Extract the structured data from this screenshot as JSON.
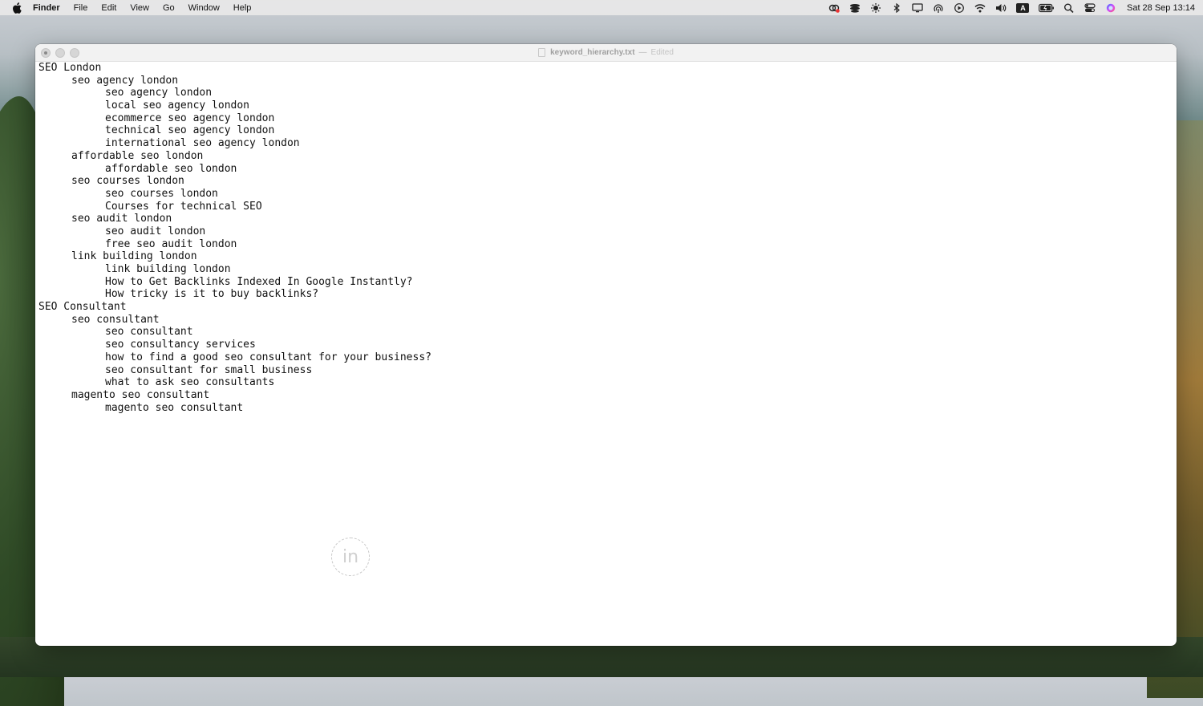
{
  "menubar": {
    "items": [
      "Finder",
      "File",
      "Edit",
      "View",
      "Go",
      "Window",
      "Help"
    ],
    "clock": "Sat 28 Sep  13:14",
    "status_icons": [
      "creative-cloud-icon",
      "stacks-icon",
      "brightness-icon",
      "bluetooth-icon",
      "display-icon",
      "airdrop-icon",
      "play-icon",
      "wifi-icon",
      "volume-icon",
      "input-source-icon",
      "battery-icon",
      "spotlight-icon",
      "control-center-icon",
      "siri-icon"
    ],
    "input_source_label": "A"
  },
  "window": {
    "filename": "keyword_hierarchy.txt",
    "separator": "—",
    "status": "Edited"
  },
  "editor": {
    "lines": [
      {
        "level": 0,
        "text": "SEO London"
      },
      {
        "level": 1,
        "text": "seo agency london"
      },
      {
        "level": 2,
        "text": "seo agency london"
      },
      {
        "level": 2,
        "text": "local seo agency london"
      },
      {
        "level": 2,
        "text": "ecommerce seo agency london"
      },
      {
        "level": 2,
        "text": "technical seo agency london"
      },
      {
        "level": 2,
        "text": "international seo agency london"
      },
      {
        "level": 1,
        "text": "affordable seo london"
      },
      {
        "level": 2,
        "text": "affordable seo london"
      },
      {
        "level": 1,
        "text": "seo courses london"
      },
      {
        "level": 2,
        "text": "seo courses london"
      },
      {
        "level": 2,
        "text": "Courses for technical SEO"
      },
      {
        "level": 1,
        "text": "seo audit london"
      },
      {
        "level": 2,
        "text": "seo audit london"
      },
      {
        "level": 2,
        "text": "free seo audit london"
      },
      {
        "level": 1,
        "text": "link building london"
      },
      {
        "level": 2,
        "text": "link building london"
      },
      {
        "level": 2,
        "text": "How to Get Backlinks Indexed In Google Instantly?"
      },
      {
        "level": 2,
        "text": "How tricky is it to buy backlinks?"
      },
      {
        "level": 0,
        "text": "SEO Consultant"
      },
      {
        "level": 1,
        "text": "seo consultant"
      },
      {
        "level": 2,
        "text": "seo consultant"
      },
      {
        "level": 2,
        "text": "seo consultancy services"
      },
      {
        "level": 2,
        "text": "how to find a good seo consultant for your business?"
      },
      {
        "level": 2,
        "text": "seo consultant for small business"
      },
      {
        "level": 2,
        "text": "what to ask seo consultants"
      },
      {
        "level": 1,
        "text": "magento seo consultant"
      },
      {
        "level": 2,
        "text": "magento seo consultant"
      }
    ]
  },
  "overlay": {
    "touch_indicator_icon": "pointer-tap-icon",
    "label": "in"
  }
}
